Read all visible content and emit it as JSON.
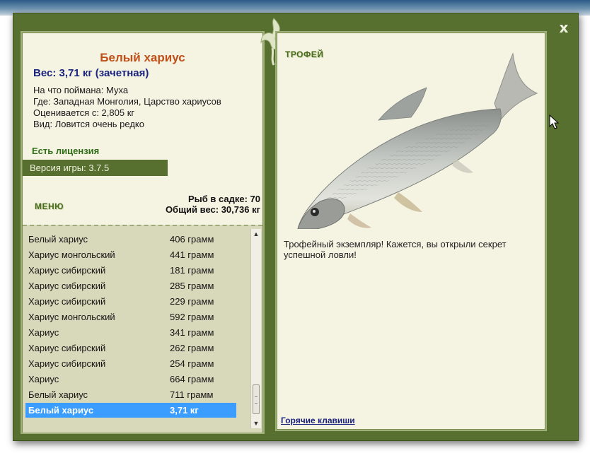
{
  "window": {
    "close_label": "x"
  },
  "fish": {
    "title": "Белый хариус",
    "weight_line": "Вес: 3,71 кг (зачетная)",
    "caught_on": "На что поймана: Муха",
    "where": "Где: Западная Монголия, Царство хариусов",
    "valued_from": "Оценивается с: 2,805 кг",
    "kind": "Вид: Ловится очень редко"
  },
  "license": "Есть лицензия",
  "version": "Версия игры: 3.7.5",
  "menu_label": "МЕНЮ",
  "stats": {
    "fish_in_keepnet": "Рыб в садке: 70",
    "total_weight": "Общий вес: 30,736 кг"
  },
  "catch_list": [
    {
      "name": "Белый хариус",
      "weight": "406 грамм"
    },
    {
      "name": "Хариус монгольский",
      "weight": "441 грамм"
    },
    {
      "name": "Хариус сибирский",
      "weight": "181 грамм"
    },
    {
      "name": "Хариус сибирский",
      "weight": "285 грамм"
    },
    {
      "name": "Хариус сибирский",
      "weight": "229 грамм"
    },
    {
      "name": "Хариус монгольский",
      "weight": "592 грамм"
    },
    {
      "name": "Хариус",
      "weight": "341 грамм"
    },
    {
      "name": "Хариус сибирский",
      "weight": "262 грамм"
    },
    {
      "name": "Хариус сибирский",
      "weight": "254 грамм"
    },
    {
      "name": "Хариус",
      "weight": "664 грамм"
    },
    {
      "name": "Белый хариус",
      "weight": "711 грамм"
    },
    {
      "name": "Белый хариус",
      "weight": "3,71 кг",
      "selected": true
    }
  ],
  "trophy": {
    "heading": "ТРОФЕЙ",
    "text": "Трофейный экземпляр! Кажется, вы открыли секрет успешной ловли!",
    "hotkeys_link": "Горячие клавиши"
  },
  "colors": {
    "frame": "#58702f",
    "panel": "#f5f3e2",
    "list_bg": "#d8d8bb",
    "selected_row": "#3a9dff",
    "title": "#c0501a",
    "weight": "#1a237e",
    "license": "#2e6e17"
  },
  "icons": {
    "close": "close-icon",
    "ornament": "vine-ornament-icon",
    "cursor": "mouse-cursor-icon"
  }
}
